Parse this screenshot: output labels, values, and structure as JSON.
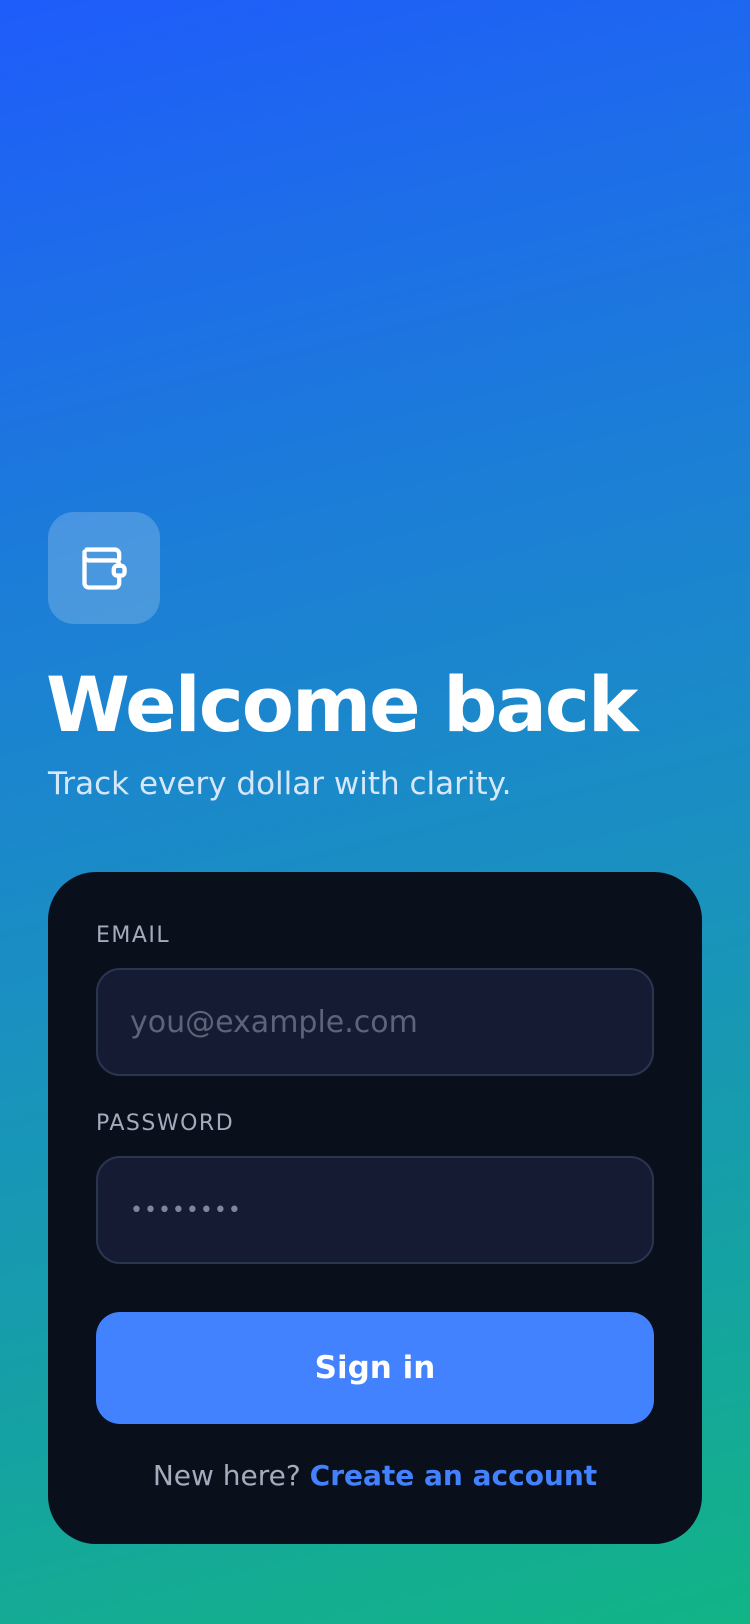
{
  "header": {
    "app_icon": "wallet-icon",
    "title": "Welcome back",
    "subtitle": "Track every dollar with clarity."
  },
  "form": {
    "email": {
      "label": "EMAIL",
      "placeholder": "you@example.com",
      "value": ""
    },
    "password": {
      "label": "PASSWORD",
      "masked_value": "••••••••"
    },
    "submit_label": "Sign in",
    "footer_prompt": "New here?",
    "footer_link": "Create an account"
  },
  "colors": {
    "gradient_start": "#1f5cfb",
    "gradient_end": "#12b486",
    "card_background": "#0a0f1c",
    "input_background": "#141b33",
    "accent": "#4382ff",
    "label_text": "#a3acbd"
  }
}
